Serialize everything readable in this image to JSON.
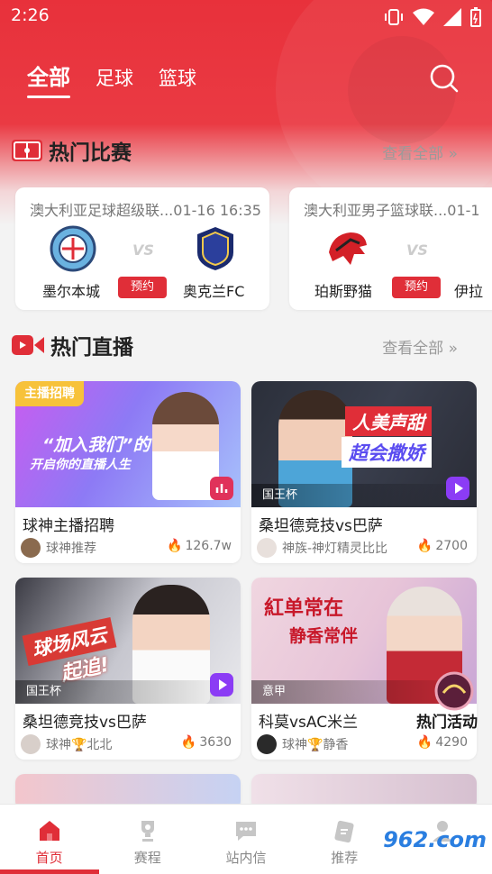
{
  "status_bar": {
    "time": "2:26"
  },
  "top_tabs": [
    {
      "label": "全部",
      "active": true
    },
    {
      "label": "足球",
      "active": false
    },
    {
      "label": "篮球",
      "active": false
    }
  ],
  "hot_matches": {
    "title": "热门比赛",
    "more": "查看全部 »",
    "cards": [
      {
        "league": "澳大利亚足球超级联...01-16 16:35",
        "home": "墨尔本城",
        "away": "奥克兰FC",
        "button": "预约"
      },
      {
        "league": "澳大利亚男子篮球联...01-1",
        "home": "珀斯野猫",
        "away": "伊拉",
        "button": "预约"
      }
    ]
  },
  "hot_live": {
    "title": "热门直播",
    "more": "查看全部 »",
    "cards": [
      {
        "title": "球神主播招聘",
        "author": "球神推荐",
        "hot": "126.7w",
        "top_tag": "主播招聘",
        "thumb_text1": "“加入我们”的",
        "thumb_text2": "开启你的直播人生"
      },
      {
        "title": "桑坦德竞技vs巴萨",
        "author": "神族-神灯精灵比比",
        "hot": "2700",
        "bottom_tag": "国王杯",
        "thumb_text1": "人美声甜",
        "thumb_text2": "超会撒娇"
      },
      {
        "title": "桑坦德竞技vs巴萨",
        "author": "球神🏆北北",
        "hot": "3630",
        "bottom_tag": "国王杯",
        "thumb_text1": "球场风云",
        "thumb_text2": "起追!"
      },
      {
        "title": "科莫vsAC米兰",
        "author": "球神🏆静香",
        "hot": "4290",
        "bottom_tag": "意甲",
        "thumb_text1": "紅单常在",
        "thumb_text2": "静香常伴"
      }
    ]
  },
  "activity_float": {
    "label": "热门活动"
  },
  "bottom_nav": [
    {
      "label": "首页",
      "active": true
    },
    {
      "label": "赛程",
      "active": false
    },
    {
      "label": "站内信",
      "active": false
    },
    {
      "label": "推荐",
      "active": false
    }
  ],
  "watermark": "962.com",
  "colors": {
    "primary": "#e02e38",
    "header": "#ea3a43"
  }
}
